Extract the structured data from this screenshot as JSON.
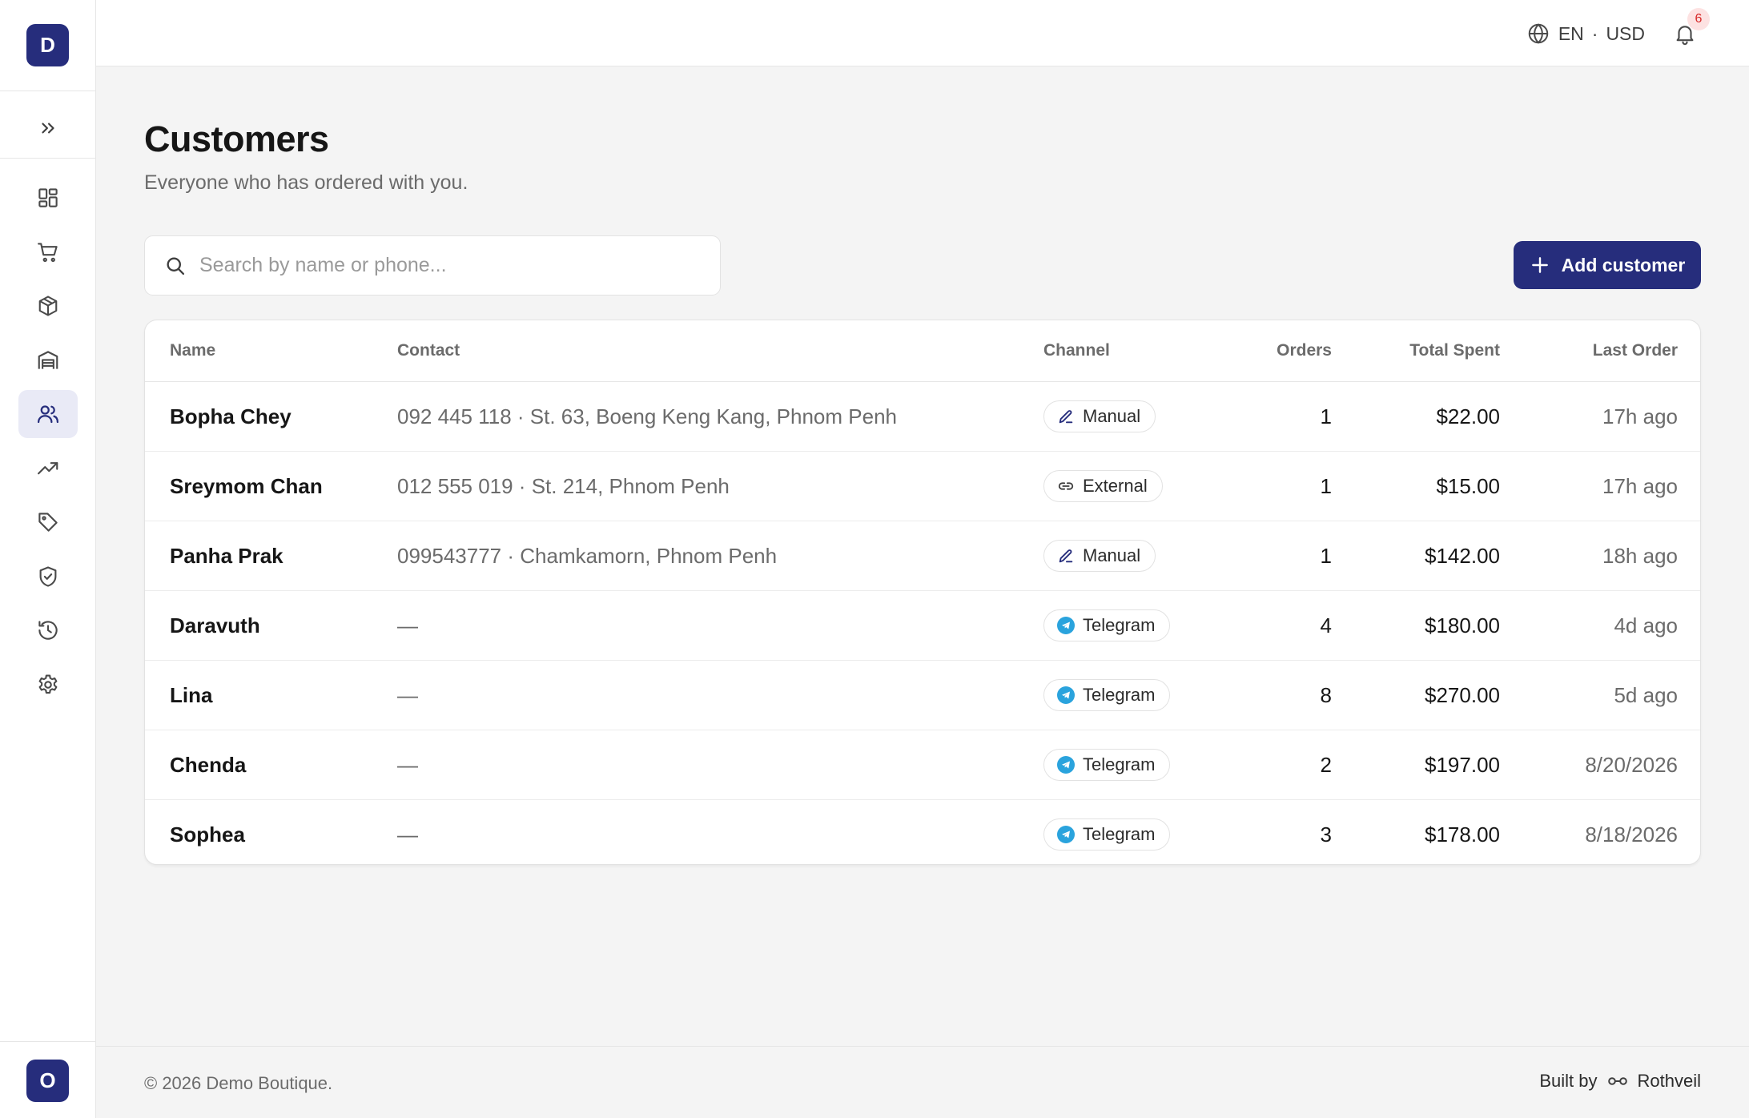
{
  "sidebar": {
    "logo_letter": "D",
    "expand_icon": "chevrons-right-icon",
    "items": [
      {
        "name": "dashboard",
        "icon": "grid-icon",
        "active": false
      },
      {
        "name": "orders",
        "icon": "cart-icon",
        "active": false
      },
      {
        "name": "products",
        "icon": "box-icon",
        "active": false
      },
      {
        "name": "inventory",
        "icon": "warehouse-icon",
        "active": false
      },
      {
        "name": "customers",
        "icon": "users-icon",
        "active": true
      },
      {
        "name": "analytics",
        "icon": "trending-up-icon",
        "active": false
      },
      {
        "name": "discounts",
        "icon": "tag-icon",
        "active": false
      },
      {
        "name": "security",
        "icon": "shield-check-icon",
        "active": false
      },
      {
        "name": "history",
        "icon": "history-icon",
        "active": false
      },
      {
        "name": "settings",
        "icon": "gear-icon",
        "active": false
      }
    ],
    "avatar_letter": "O"
  },
  "topbar": {
    "language": "EN",
    "separator": "·",
    "currency": "USD",
    "notification_count": "6"
  },
  "page": {
    "title": "Customers",
    "subtitle": "Everyone who has ordered with you."
  },
  "search": {
    "placeholder": "Search by name or phone...",
    "value": ""
  },
  "add_button": {
    "label": "Add customer"
  },
  "table": {
    "columns": {
      "name": "Name",
      "contact": "Contact",
      "channel": "Channel",
      "orders": "Orders",
      "total_spent": "Total Spent",
      "last_order": "Last Order"
    },
    "rows": [
      {
        "name": "Bopha Chey",
        "contact": "092 445 118 · St. 63, Boeng Keng Kang, Phnom Penh",
        "channel": "Manual",
        "channel_icon": "pencil-icon",
        "orders": "1",
        "total_spent": "$22.00",
        "last_order": "17h ago"
      },
      {
        "name": "Sreymom Chan",
        "contact": "012 555 019 · St. 214, Phnom Penh",
        "channel": "External",
        "channel_icon": "link-icon",
        "orders": "1",
        "total_spent": "$15.00",
        "last_order": "17h ago"
      },
      {
        "name": "Panha Prak",
        "contact": "099543777 · Chamkamorn, Phnom Penh",
        "channel": "Manual",
        "channel_icon": "pencil-icon",
        "orders": "1",
        "total_spent": "$142.00",
        "last_order": "18h ago"
      },
      {
        "name": "Daravuth",
        "contact": "—",
        "channel": "Telegram",
        "channel_icon": "telegram-icon",
        "orders": "4",
        "total_spent": "$180.00",
        "last_order": "4d ago"
      },
      {
        "name": "Lina",
        "contact": "—",
        "channel": "Telegram",
        "channel_icon": "telegram-icon",
        "orders": "8",
        "total_spent": "$270.00",
        "last_order": "5d ago"
      },
      {
        "name": "Chenda",
        "contact": "—",
        "channel": "Telegram",
        "channel_icon": "telegram-icon",
        "orders": "2",
        "total_spent": "$197.00",
        "last_order": "8/20/2026"
      },
      {
        "name": "Sophea",
        "contact": "—",
        "channel": "Telegram",
        "channel_icon": "telegram-icon",
        "orders": "3",
        "total_spent": "$178.00",
        "last_order": "8/18/2026"
      }
    ]
  },
  "footer": {
    "copyright": "© 2026 Demo Boutique.",
    "built_by": "Built by",
    "brand": "Rothveil"
  },
  "colors": {
    "accent": "#262d7c",
    "background": "#f4f4f4",
    "telegram": "#2aa3dd",
    "badge_bg": "#fde2e2",
    "badge_text": "#d62828"
  }
}
